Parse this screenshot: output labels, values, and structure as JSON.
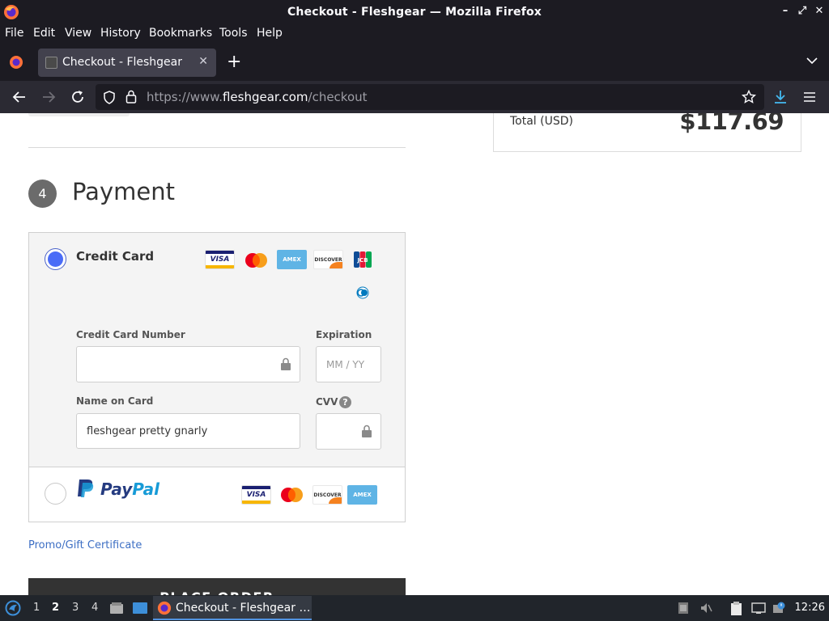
{
  "window": {
    "title": "Checkout - Fleshgear — Mozilla Firefox",
    "minimize": "–",
    "maximize": "⤢",
    "close": "✕"
  },
  "menu": [
    "File",
    "Edit",
    "View",
    "History",
    "Bookmarks",
    "Tools",
    "Help"
  ],
  "tab": {
    "title": "Checkout - Fleshgear",
    "close": "✕",
    "new_tab": "+"
  },
  "url": {
    "prefix": "https://www.",
    "domain": "fleshgear.com",
    "path": "/checkout"
  },
  "summary": {
    "total_label": "Total (USD)",
    "total_value": "$117.69"
  },
  "payment": {
    "step_number": "4",
    "title": "Payment",
    "credit_card": {
      "label": "Credit Card",
      "selected": true,
      "logos": [
        "VISA",
        "mastercard",
        "AMEX",
        "DISCOVER",
        "JCB",
        "Diners Club"
      ],
      "fields": {
        "number_label": "Credit Card Number",
        "number_value": "",
        "expiration_label": "Expiration",
        "expiration_placeholder": "MM / YY",
        "name_label": "Name on Card",
        "name_value": "fleshgear pretty gnarly",
        "cvv_label": "CVV",
        "cvv_help": "?"
      }
    },
    "paypal": {
      "label_a": "Pay",
      "label_b": "Pal",
      "selected": false,
      "logos": [
        "VISA",
        "mastercard",
        "DISCOVER",
        "AMEX"
      ]
    },
    "promo_link": "Promo/Gift Certificate",
    "place_order": "PLACE ORDER"
  },
  "taskbar": {
    "workspaces": [
      "1",
      "2",
      "3",
      "4"
    ],
    "active_workspace": "2",
    "task_label": "Checkout - Fleshgear …",
    "clock": "12:26"
  },
  "colors": {
    "accent": "#4a6cf7",
    "browser_chrome": "#1c1b22",
    "link": "#3d6fc4",
    "button": "#333333"
  }
}
